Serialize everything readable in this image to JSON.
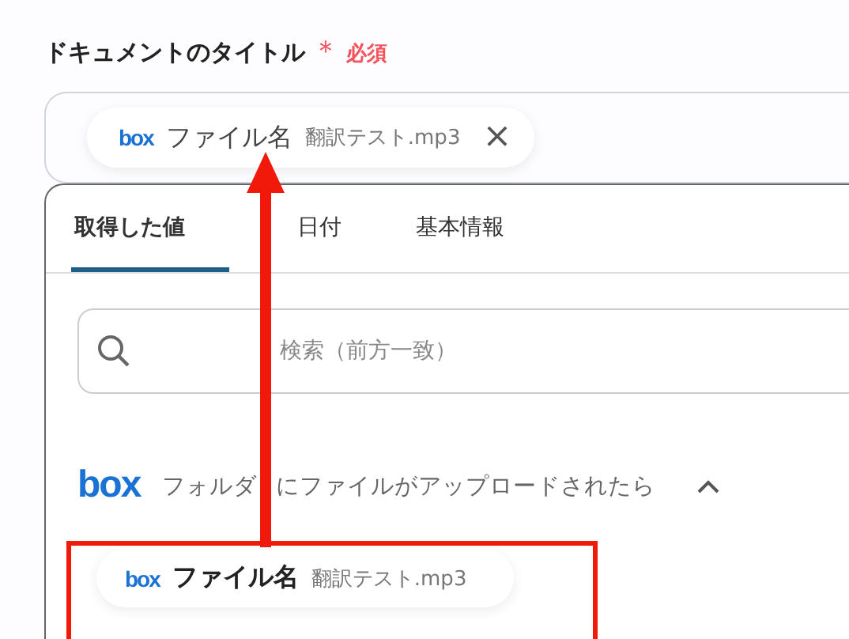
{
  "field": {
    "label": "ドキュメントのタイトル",
    "required_mark": "＊",
    "required_text": "必須",
    "token": {
      "logo": "box",
      "name": "ファイル名",
      "value": "翻訳テスト.mp3",
      "remove": "×"
    }
  },
  "tabs": [
    {
      "label": "取得した値",
      "selected": true
    },
    {
      "label": "日付",
      "selected": false
    },
    {
      "label": "基本情報",
      "selected": false
    }
  ],
  "search": {
    "placeholder": "検索（前方一致）"
  },
  "section": {
    "logo": "box",
    "title": "フォルダにファイルがアップロードされたら",
    "expanded": true,
    "items": [
      {
        "logo": "box",
        "name": "ファイル名",
        "value": "翻訳テスト.mp3"
      }
    ]
  }
}
